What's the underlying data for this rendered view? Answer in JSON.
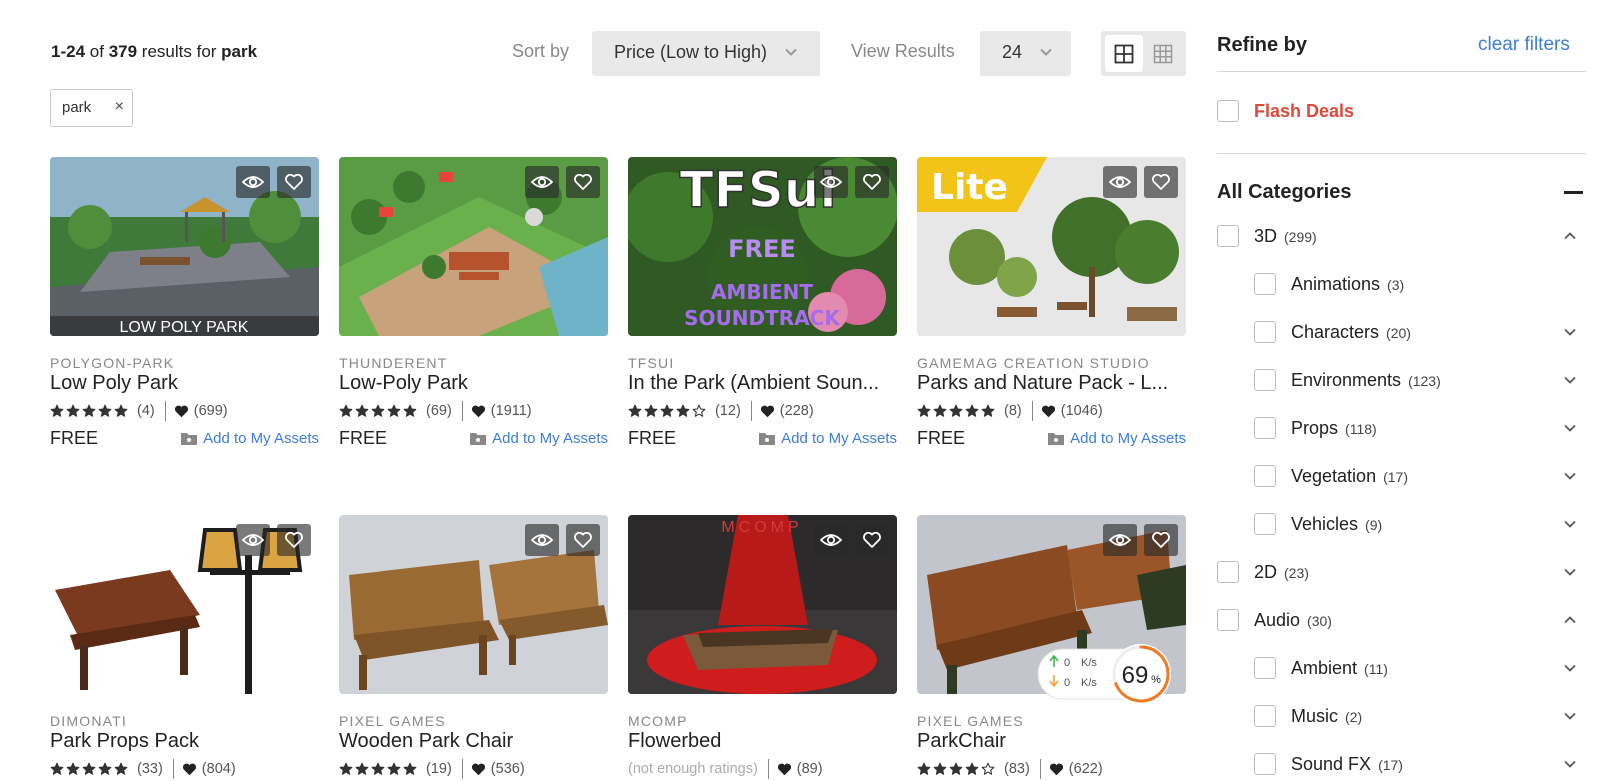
{
  "header": {
    "range": "1-24",
    "of_text": "of",
    "total": "379",
    "results_for": "results for",
    "query": "park",
    "sort_label": "Sort by",
    "sort_value": "Price (Low to High)",
    "view_label": "View Results",
    "view_value": "24"
  },
  "filter_chip": {
    "label": "park",
    "remove_glyph": "×"
  },
  "icons": {
    "grid-large": "grid-large-icon",
    "grid-small": "grid-small-icon",
    "eye": "eye-icon",
    "heart": "heart-outline-icon",
    "heart-filled": "heart-filled-icon",
    "star": "star-icon",
    "asset": "folder-icon",
    "chevron": "chevron-down-icon"
  },
  "colors": {
    "link": "#3b7dd8",
    "flash": "#e0483a",
    "text": "#222222",
    "muted": "#888888",
    "select_bg": "#e9e9e9"
  },
  "products": [
    {
      "publisher": "POLYGON-PARK",
      "title": "Low Poly Park",
      "stars": 5,
      "rating_count": "(4)",
      "favorites": "(699)",
      "price": "FREE",
      "add_label": "Add to My Assets",
      "thumb_text": "LOW POLY PARK"
    },
    {
      "publisher": "THUNDERENT",
      "title": "Low-Poly Park",
      "stars": 5,
      "rating_count": "(69)",
      "favorites": "(1911)",
      "price": "FREE",
      "add_label": "Add to My Assets"
    },
    {
      "publisher": "TFSUI",
      "title": "In the Park (Ambient Soun...",
      "stars": 4,
      "rating_count": "(12)",
      "favorites": "(228)",
      "price": "FREE",
      "add_label": "Add to My Assets",
      "thumb_text_1": "TFSui",
      "thumb_text_2": "FREE",
      "thumb_text_3": "AMBIENT",
      "thumb_text_4": "SOUNDTRACK"
    },
    {
      "publisher": "GAMEMAG CREATION STUDIO",
      "title": "Parks and Nature Pack - L...",
      "stars": 5,
      "rating_count": "(8)",
      "favorites": "(1046)",
      "price": "FREE",
      "add_label": "Add to My Assets",
      "thumb_text": "Lite"
    },
    {
      "publisher": "DIMONATI",
      "title": "Park Props Pack",
      "stars": 5,
      "rating_count": "(33)",
      "favorites": "(804)"
    },
    {
      "publisher": "PIXEL GAMES",
      "title": "Wooden Park Chair",
      "stars": 5,
      "rating_count": "(19)",
      "favorites": "(536)"
    },
    {
      "publisher": "MCOMP",
      "title": "Flowerbed",
      "stars": 0,
      "no_ratings": "(not enough ratings)",
      "favorites": "(89)",
      "thumb_text": "MCOMP"
    },
    {
      "publisher": "PIXEL GAMES",
      "title": "ParkChair",
      "stars": 4,
      "rating_count": "(83)",
      "favorites": "(622)"
    }
  ],
  "widget": {
    "up": "0",
    "down": "0",
    "unit": "K/s",
    "percent": "69",
    "percent_sign": "%"
  },
  "sidebar": {
    "title": "Refine by",
    "clear": "clear filters",
    "flash_deals": "Flash Deals",
    "all_categories": "All Categories",
    "categories": [
      {
        "label": "3D",
        "count": "(299)",
        "level": 0,
        "expanded": true
      },
      {
        "label": "Animations",
        "count": "(3)",
        "level": 1,
        "expanded": false,
        "no_chevron": true
      },
      {
        "label": "Characters",
        "count": "(20)",
        "level": 1,
        "expanded": false
      },
      {
        "label": "Environments",
        "count": "(123)",
        "level": 1,
        "expanded": false
      },
      {
        "label": "Props",
        "count": "(118)",
        "level": 1,
        "expanded": false
      },
      {
        "label": "Vegetation",
        "count": "(17)",
        "level": 1,
        "expanded": false
      },
      {
        "label": "Vehicles",
        "count": "(9)",
        "level": 1,
        "expanded": false
      },
      {
        "label": "2D",
        "count": "(23)",
        "level": 0,
        "expanded": false
      },
      {
        "label": "Audio",
        "count": "(30)",
        "level": 0,
        "expanded": true
      },
      {
        "label": "Ambient",
        "count": "(11)",
        "level": 1,
        "expanded": false
      },
      {
        "label": "Music",
        "count": "(2)",
        "level": 1,
        "expanded": false
      },
      {
        "label": "Sound FX",
        "count": "(17)",
        "level": 1,
        "expanded": false
      }
    ]
  }
}
